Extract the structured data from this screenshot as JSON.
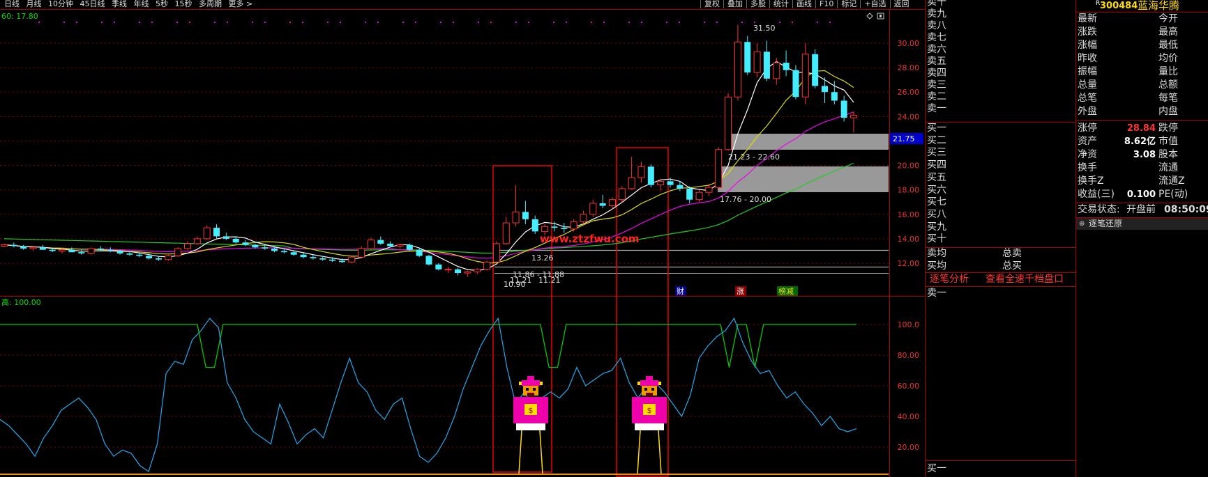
{
  "toolbar": {
    "periods": [
      "日线",
      "月线",
      "10分钟",
      "45日线",
      "季线",
      "年线",
      "5秒",
      "15秒",
      "多周期",
      "更多 >"
    ],
    "right_buttons": [
      "复权",
      "叠加",
      "多股",
      "统计",
      "画线",
      "F10",
      "标记",
      "+自选",
      "返回"
    ]
  },
  "chart": {
    "ma_header": "60: 17.80",
    "price_ticks": [
      "30.00",
      "28.00",
      "26.00",
      "24.00",
      "22.00",
      "20.00",
      "18.00",
      "16.00",
      "14.00",
      "12.00"
    ],
    "current_price_box": "21.75",
    "annotations": {
      "high": "31.50",
      "zone_upper": "21.23 - 22.60",
      "zone_lower": "17.76 - 20.00",
      "low_zone_a": "13.26",
      "low_zone_b": "11.86 - 11.88",
      "low_a": "11.21",
      "low_b": "11.21",
      "low_c": "10.90"
    },
    "watermark": "www.ztzfwu.com",
    "tags": [
      "财",
      "涨",
      "榜减"
    ],
    "indicator_header": "高: 100.00",
    "indicator_ticks": [
      "100.0",
      "80.00",
      "60.00",
      "40.00",
      "20.00"
    ]
  },
  "orderbook": {
    "sells": [
      "卖十",
      "卖九",
      "卖八",
      "卖七",
      "卖六",
      "卖五",
      "卖四",
      "卖三",
      "卖二",
      "卖一"
    ],
    "buys": [
      "买一",
      "买二",
      "买三",
      "买四",
      "买五",
      "买六",
      "买七",
      "买八",
      "买九",
      "买十"
    ],
    "sell_avg": "卖均",
    "sell_total": "总卖",
    "buy_avg": "买均",
    "buy_total": "总买",
    "link_tick": "逐笔分析",
    "link_depth": "查看全速千档盘口",
    "sell1": "卖一",
    "buy1": "买一"
  },
  "quote": {
    "badge": "R",
    "code": "300484",
    "name": "蓝海华腾",
    "rows_top": [
      {
        "l": "最新",
        "r": "今开"
      },
      {
        "l": "涨跌",
        "r": "最高"
      },
      {
        "l": "涨幅",
        "r": "最低"
      },
      {
        "l": "昨收",
        "r": "均价"
      },
      {
        "l": "振幅",
        "r": "量比"
      },
      {
        "l": "总量",
        "r": "总额"
      },
      {
        "l": "总笔",
        "r": "每笔"
      },
      {
        "l": "外盘",
        "r": "内盘"
      }
    ],
    "rows_bottom": [
      {
        "l": "涨停",
        "v": "28.84",
        "r": "跌停"
      },
      {
        "l": "资产",
        "v": "8.62亿",
        "r": "市值"
      },
      {
        "l": "净资",
        "v": "3.08",
        "r": "股本"
      },
      {
        "l": "换手",
        "v": "",
        "r": "流通"
      },
      {
        "l": "换手Z",
        "v": "",
        "r": "流通Z"
      },
      {
        "l": "收益(三)",
        "v": "0.100",
        "r": "PE(动)"
      }
    ],
    "trade_state_label": "交易状态:",
    "trade_state": "开盘前",
    "time": "08:50:09",
    "tick_restore": "逐笔还原"
  },
  "chart_data": {
    "type": "candlestick",
    "price_range": [
      10.5,
      32.0
    ],
    "indicator_range": [
      0,
      110
    ],
    "candles": [
      [
        13.4,
        13.6,
        13.3,
        13.5
      ],
      [
        13.5,
        13.7,
        13.3,
        13.4
      ],
      [
        13.4,
        13.5,
        13.1,
        13.2
      ],
      [
        13.2,
        13.4,
        13.0,
        13.3
      ],
      [
        13.3,
        13.5,
        13.1,
        13.1
      ],
      [
        13.1,
        13.2,
        12.9,
        13.0
      ],
      [
        13.0,
        13.2,
        12.8,
        13.1
      ],
      [
        13.1,
        13.3,
        12.9,
        12.9
      ],
      [
        12.9,
        13.1,
        12.7,
        12.8
      ],
      [
        12.8,
        13.3,
        12.7,
        13.2
      ],
      [
        13.2,
        13.4,
        13.0,
        13.1
      ],
      [
        13.1,
        13.3,
        12.9,
        13.0
      ],
      [
        13.0,
        13.1,
        12.7,
        12.8
      ],
      [
        12.8,
        13.0,
        12.6,
        12.7
      ],
      [
        12.7,
        12.9,
        12.5,
        12.6
      ],
      [
        12.6,
        12.8,
        12.3,
        12.4
      ],
      [
        12.4,
        12.6,
        12.2,
        12.3
      ],
      [
        12.3,
        12.7,
        12.2,
        12.6
      ],
      [
        12.6,
        13.3,
        12.5,
        13.2
      ],
      [
        13.2,
        13.8,
        13.1,
        13.6
      ],
      [
        13.6,
        14.2,
        13.5,
        14.0
      ],
      [
        14.0,
        15.1,
        13.9,
        14.9
      ],
      [
        14.9,
        15.2,
        14.0,
        14.2
      ],
      [
        14.2,
        14.5,
        13.9,
        14.0
      ],
      [
        14.0,
        14.2,
        13.6,
        13.7
      ],
      [
        13.7,
        13.9,
        13.4,
        13.5
      ],
      [
        13.5,
        13.6,
        13.2,
        13.3
      ],
      [
        13.3,
        13.5,
        13.1,
        13.2
      ],
      [
        13.2,
        13.4,
        12.9,
        13.0
      ],
      [
        13.0,
        13.2,
        12.8,
        12.9
      ],
      [
        12.9,
        13.0,
        12.6,
        12.7
      ],
      [
        12.7,
        12.9,
        12.4,
        12.5
      ],
      [
        12.5,
        12.7,
        12.3,
        12.4
      ],
      [
        12.4,
        12.6,
        12.2,
        12.3
      ],
      [
        12.3,
        12.5,
        12.1,
        12.2
      ],
      [
        12.2,
        12.4,
        12.0,
        12.1
      ],
      [
        12.1,
        12.6,
        12.0,
        12.5
      ],
      [
        12.5,
        13.4,
        12.4,
        13.2
      ],
      [
        13.2,
        14.1,
        13.1,
        13.9
      ],
      [
        13.9,
        14.2,
        13.5,
        13.6
      ],
      [
        13.6,
        13.8,
        13.3,
        13.4
      ],
      [
        13.4,
        13.6,
        13.2,
        13.5
      ],
      [
        13.5,
        13.6,
        13.0,
        13.1
      ],
      [
        13.1,
        13.2,
        12.5,
        12.6
      ],
      [
        12.6,
        12.7,
        11.8,
        11.9
      ],
      [
        11.9,
        12.0,
        11.4,
        11.5
      ],
      [
        11.5,
        11.7,
        11.2,
        11.5
      ],
      [
        11.5,
        11.6,
        11.0,
        11.2
      ],
      [
        11.2,
        11.4,
        10.9,
        11.3
      ],
      [
        11.3,
        11.6,
        11.1,
        11.5
      ],
      [
        11.5,
        12.2,
        11.4,
        12.1
      ],
      [
        12.1,
        13.8,
        12.0,
        13.6
      ],
      [
        13.6,
        15.8,
        13.5,
        15.3
      ],
      [
        15.3,
        18.4,
        15.0,
        16.2
      ],
      [
        16.2,
        17.1,
        15.2,
        15.6
      ],
      [
        15.6,
        15.9,
        14.4,
        14.6
      ],
      [
        14.6,
        15.2,
        14.3,
        15.0
      ],
      [
        15.0,
        15.4,
        14.6,
        14.9
      ],
      [
        14.9,
        15.3,
        14.5,
        14.8
      ],
      [
        14.8,
        15.6,
        14.6,
        15.4
      ],
      [
        15.4,
        16.3,
        15.2,
        16.0
      ],
      [
        16.0,
        17.2,
        15.8,
        16.9
      ],
      [
        16.9,
        17.6,
        16.5,
        16.7
      ],
      [
        16.7,
        17.4,
        16.4,
        17.2
      ],
      [
        17.2,
        18.3,
        17.0,
        18.1
      ],
      [
        18.1,
        20.7,
        18.0,
        19.0
      ],
      [
        19.0,
        20.3,
        18.6,
        19.9
      ],
      [
        19.9,
        20.1,
        18.2,
        18.4
      ],
      [
        18.4,
        18.9,
        17.9,
        18.7
      ],
      [
        18.7,
        19.0,
        18.2,
        18.4
      ],
      [
        18.4,
        18.7,
        17.9,
        18.1
      ],
      [
        18.1,
        18.3,
        16.9,
        17.2
      ],
      [
        17.2,
        18.0,
        17.0,
        17.8
      ],
      [
        17.8,
        18.5,
        17.5,
        18.2
      ],
      [
        18.2,
        21.5,
        18.1,
        21.3
      ],
      [
        21.3,
        25.9,
        21.2,
        25.6
      ],
      [
        25.6,
        31.5,
        25.3,
        30.1
      ],
      [
        30.1,
        30.6,
        27.4,
        27.6
      ],
      [
        27.6,
        30.0,
        27.2,
        29.3
      ],
      [
        29.3,
        30.2,
        26.9,
        27.1
      ],
      [
        27.1,
        28.8,
        26.6,
        28.4
      ],
      [
        28.4,
        29.4,
        27.3,
        27.8
      ],
      [
        27.8,
        28.2,
        25.4,
        25.6
      ],
      [
        25.6,
        30.0,
        25.0,
        29.1
      ],
      [
        29.1,
        29.5,
        26.3,
        26.5
      ],
      [
        26.5,
        27.2,
        25.1,
        26.0
      ],
      [
        26.0,
        26.9,
        25.0,
        25.3
      ],
      [
        25.3,
        25.7,
        23.6,
        23.9
      ],
      [
        23.9,
        24.4,
        22.7,
        24.1
      ]
    ],
    "indicator_line": [
      38,
      34,
      28,
      22,
      14,
      26,
      34,
      44,
      48,
      52,
      46,
      38,
      22,
      14,
      18,
      16,
      8,
      4,
      22,
      68,
      76,
      74,
      90,
      96,
      104,
      98,
      62,
      52,
      38,
      30,
      26,
      22,
      48,
      36,
      22,
      28,
      32,
      26,
      44,
      62,
      78,
      62,
      56,
      44,
      38,
      48,
      52,
      32,
      14,
      10,
      16,
      26,
      40,
      58,
      72,
      86,
      96,
      104,
      72,
      48,
      56,
      46,
      52,
      56,
      52,
      58,
      72,
      60,
      64,
      68,
      70,
      78,
      62,
      52,
      60,
      62,
      56,
      48,
      40,
      54,
      78,
      86,
      92,
      96,
      104,
      88,
      76,
      68,
      70,
      60,
      52,
      56,
      48,
      42,
      34,
      40,
      32,
      30,
      32
    ]
  }
}
